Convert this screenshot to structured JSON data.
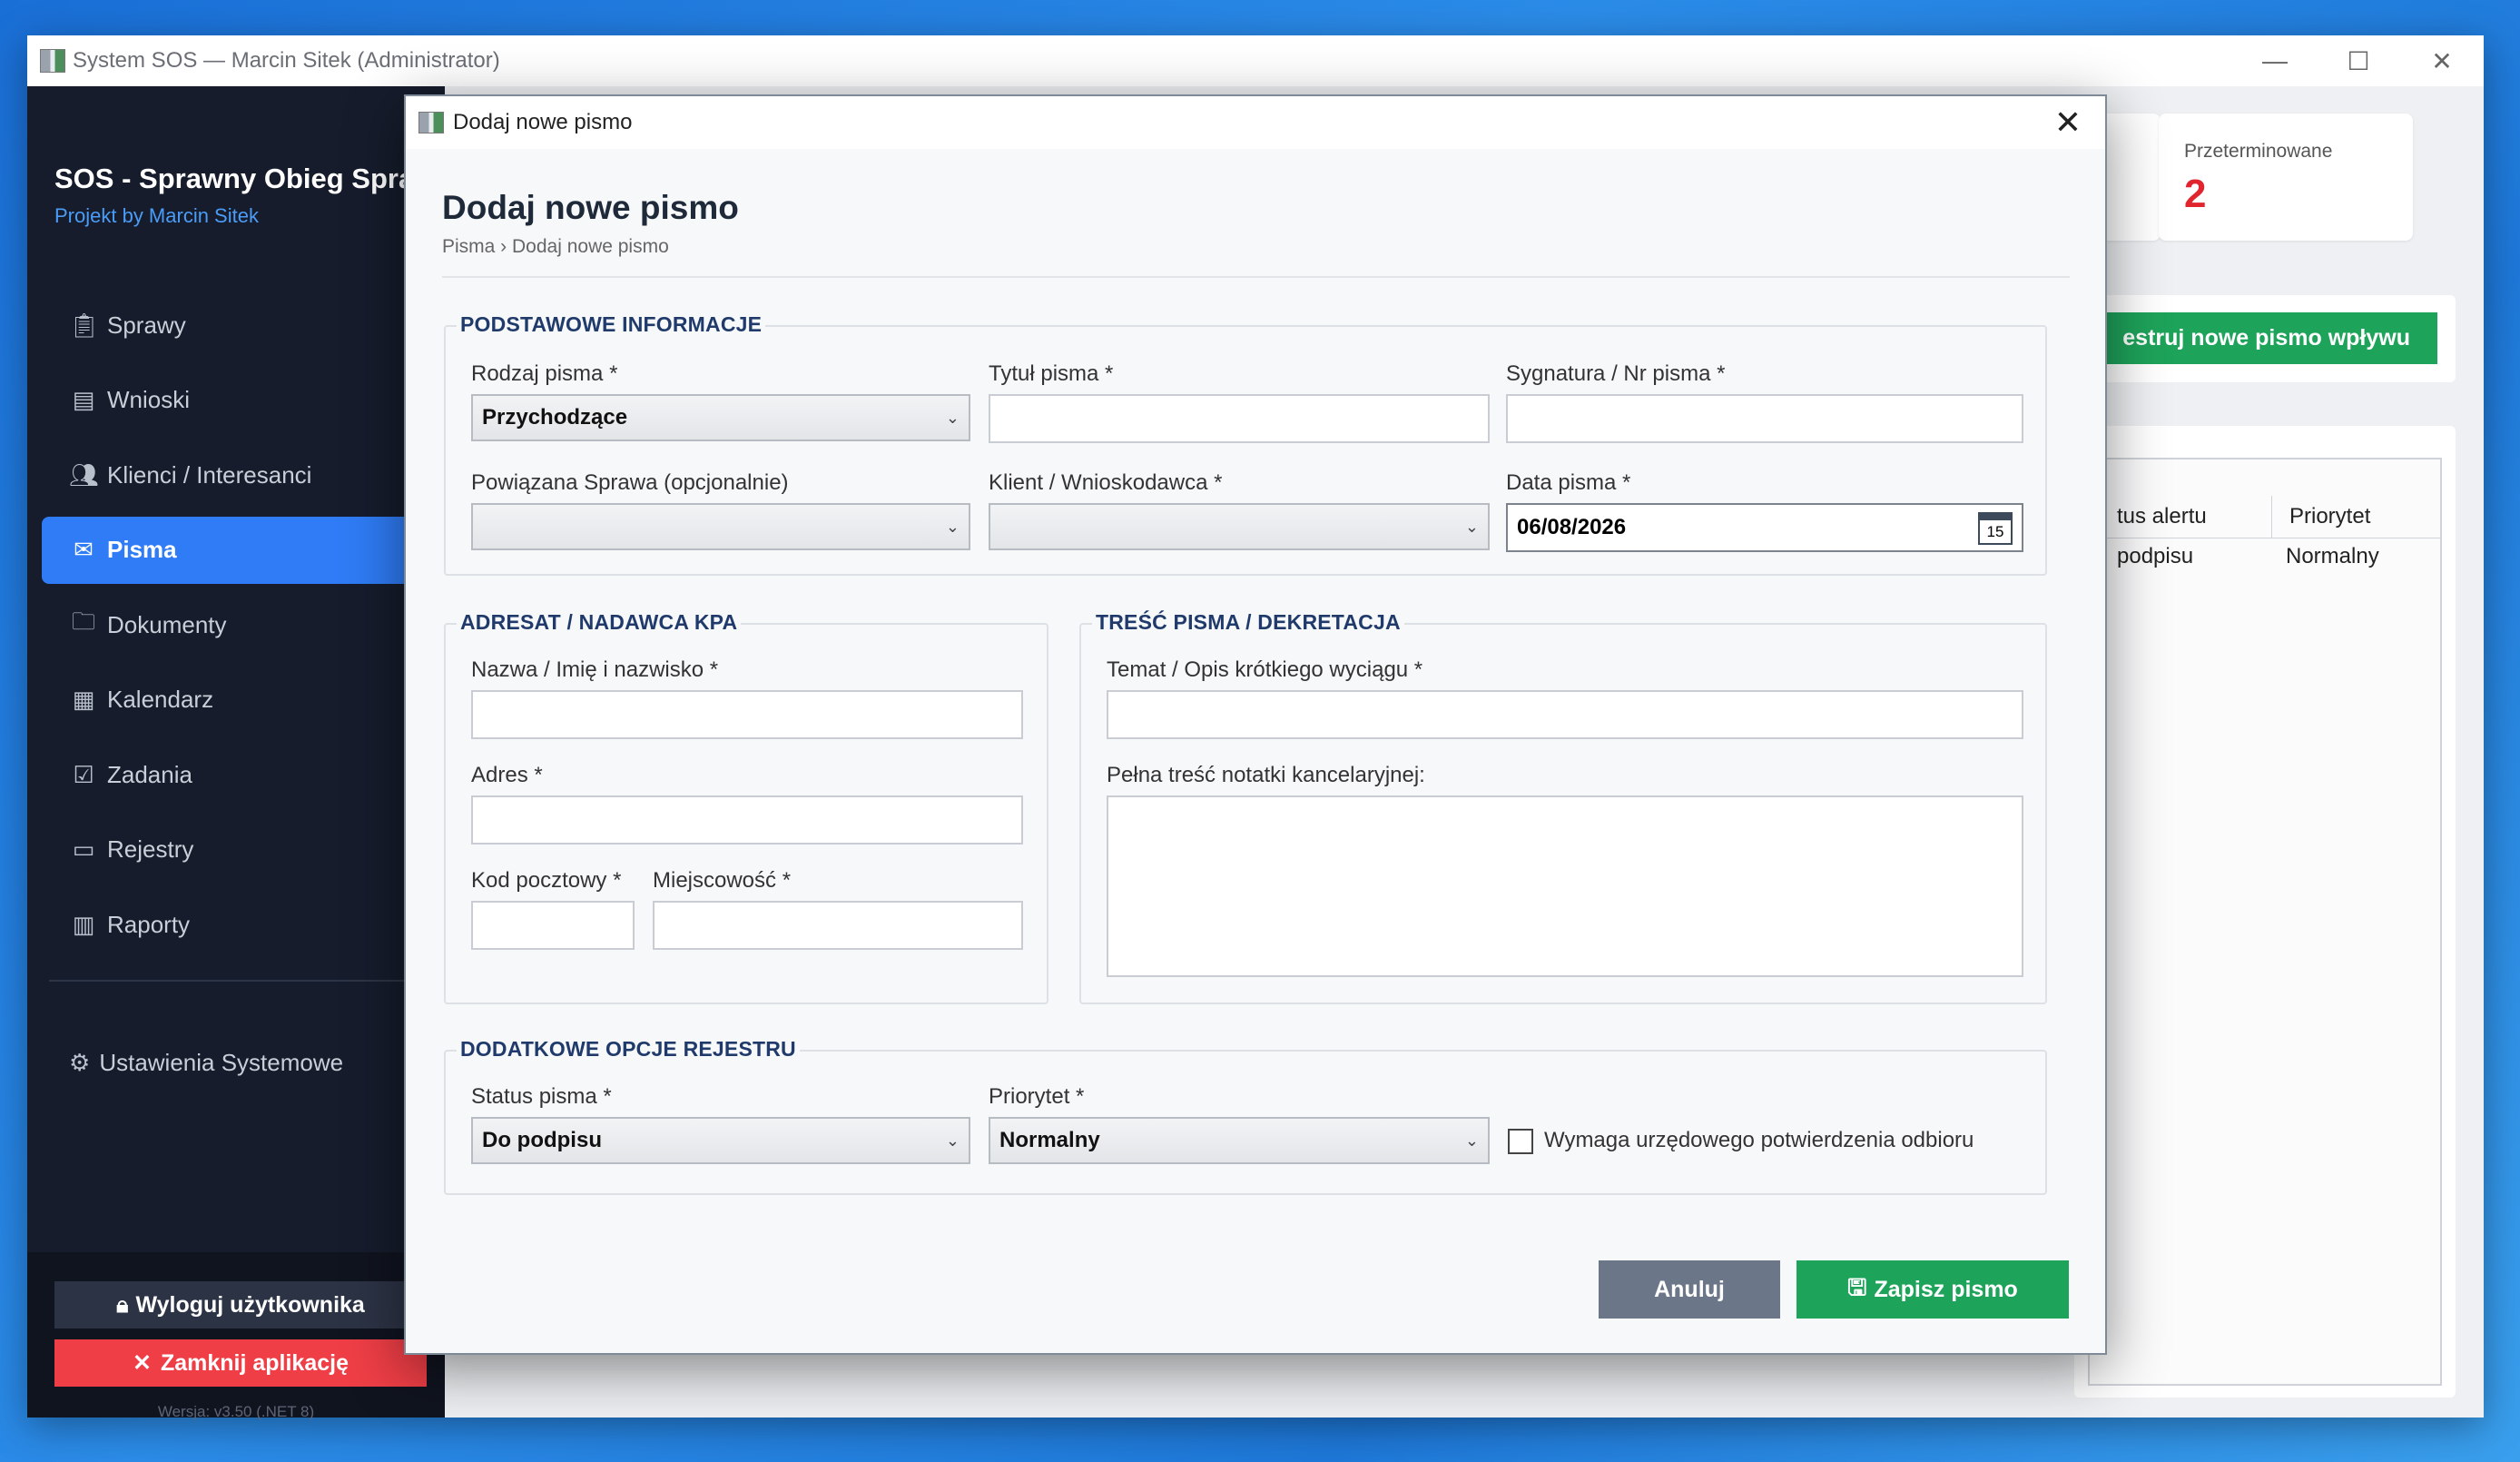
{
  "window": {
    "title": "System SOS — Marcin Sitek (Administrator)",
    "controls": [
      "minimize-icon",
      "maximize-icon",
      "close-icon"
    ]
  },
  "sidebar": {
    "brand_title": "SOS - Sprawny Obieg Spraw",
    "brand_subtitle": "Projekt by Marcin Sitek",
    "items": [
      {
        "label": "Sprawy",
        "icon": "clipboard-icon"
      },
      {
        "label": "Wnioski",
        "icon": "document-icon"
      },
      {
        "label": "Klienci / Interesanci",
        "icon": "people-icon"
      },
      {
        "label": "Pisma",
        "icon": "envelope-icon",
        "active": true
      },
      {
        "label": "Dokumenty",
        "icon": "folder-icon"
      },
      {
        "label": "Kalendarz",
        "icon": "calendar-icon"
      },
      {
        "label": "Zadania",
        "icon": "checkbox-icon"
      },
      {
        "label": "Rejestry",
        "icon": "registry-icon"
      },
      {
        "label": "Raporty",
        "icon": "bar-chart-icon"
      }
    ],
    "settings_label": "Ustawienia Systemowe",
    "logout_label": "Wyloguj użytkownika",
    "close_app_label": "Zamknij aplikację",
    "version": "Wersja: v3.50 (.NET 8)"
  },
  "background": {
    "stat_card": {
      "label": "Przeterminowane",
      "value": "2"
    },
    "register_button": "estruj nowe pismo wpływu",
    "table": {
      "headers": [
        "tus alertu",
        "Priorytet"
      ],
      "rows": [
        [
          "podpisu",
          "Normalny"
        ]
      ]
    }
  },
  "dialog": {
    "window_title": "Dodaj nowe pismo",
    "heading": "Dodaj nowe pismo",
    "breadcrumb": "Pisma › Dodaj nowe pismo",
    "basic": {
      "title": "PODSTAWOWE INFORMACJE",
      "type_label": "Rodzaj pisma *",
      "type_value": "Przychodzące",
      "title_label": "Tytuł pisma *",
      "title_value": "",
      "signature_label": "Sygnatura / Nr pisma *",
      "signature_value": "",
      "case_label": "Powiązana Sprawa (opcjonalnie)",
      "case_value": "",
      "client_label": "Klient / Wnioskodawca *",
      "client_value": "",
      "date_label": "Data pisma *",
      "date_value": "06/08/2026",
      "calendar_day": "15"
    },
    "addressee": {
      "title": "ADRESAT / NADAWCA KPA",
      "name_label": "Nazwa / Imię i nazwisko *",
      "address_label": "Adres *",
      "postal_label": "Kod pocztowy *",
      "city_label": "Miejscowość *"
    },
    "content": {
      "title": "TREŚĆ PISMA / DEKRETACJA",
      "subject_label": "Temat / Opis krótkiego wyciągu *",
      "full_label": "Pełna treść notatki kancelaryjnej:"
    },
    "extra": {
      "title": "DODATKOWE OPCJE REJESTRU",
      "status_label": "Status pisma *",
      "status_value": "Do podpisu",
      "priority_label": "Priorytet *",
      "priority_value": "Normalny",
      "confirm_label": "Wymaga urzędowego potwierdzenia odbioru",
      "confirm_checked": false
    },
    "cancel_label": "Anuluj",
    "save_label": "Zapisz pismo"
  },
  "colors": {
    "sidebar_bg": "#161c2c",
    "accent_blue": "#2f7cf6",
    "save_green": "#1ea35a",
    "danger_red": "#ef3e46",
    "group_title": "#1f3a6b"
  }
}
